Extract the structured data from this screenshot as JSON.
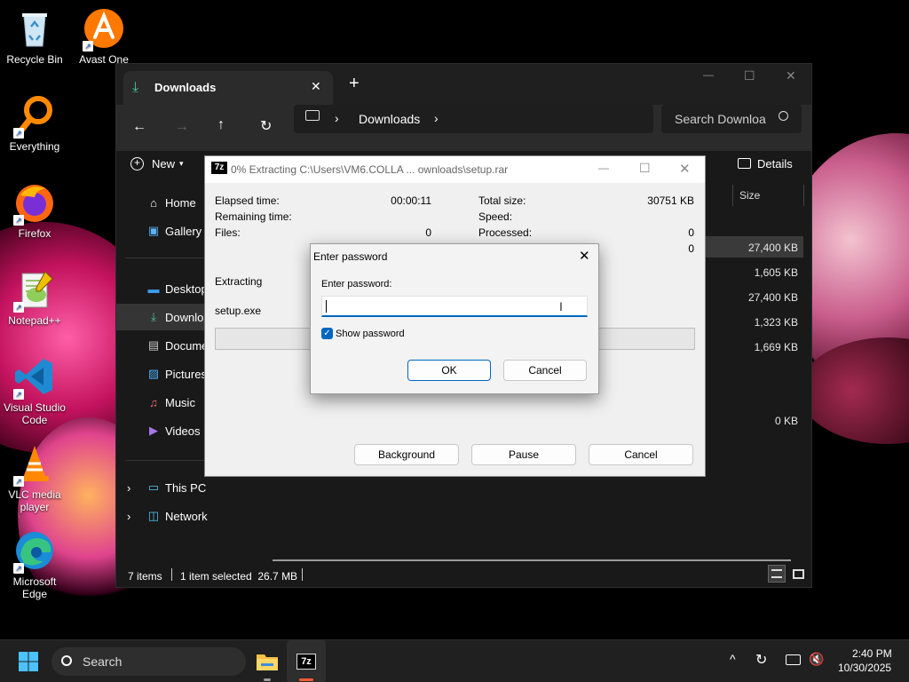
{
  "desktop": {
    "icons": [
      {
        "label": "Recycle Bin",
        "icon": "recycle-bin-icon"
      },
      {
        "label": "Avast One",
        "icon": "avast-icon"
      },
      {
        "label": "Everything",
        "icon": "everything-search-icon"
      },
      {
        "label": "Firefox",
        "icon": "firefox-icon"
      },
      {
        "label": "Notepad++",
        "icon": "notepad-plus-plus-icon"
      },
      {
        "label": "Visual Studio Code",
        "icon": "vscode-icon"
      },
      {
        "label": "VLC media player",
        "icon": "vlc-icon"
      },
      {
        "label": "Microsoft Edge",
        "icon": "edge-icon"
      }
    ]
  },
  "explorer": {
    "tab_title": "Downloads",
    "new_tab_symbol": "+",
    "window_controls": {
      "minimize": "—",
      "maximize": "☐",
      "close": "✕"
    },
    "breadcrumb": [
      "Downloads"
    ],
    "search_placeholder": "Search Downloa",
    "toolbar": {
      "new_label": "New",
      "details_label": "Details"
    },
    "column_header": "Size",
    "nav": [
      {
        "label": "Home",
        "icon": "home-icon"
      },
      {
        "label": "Gallery",
        "icon": "gallery-icon"
      },
      {
        "label": "Desktop",
        "icon": "desktop-folder-icon"
      },
      {
        "label": "Downloads",
        "icon": "download-icon"
      },
      {
        "label": "Documents",
        "icon": "documents-icon"
      },
      {
        "label": "Pictures",
        "icon": "pictures-icon"
      },
      {
        "label": "Music",
        "icon": "music-icon"
      },
      {
        "label": "Videos",
        "icon": "videos-icon"
      },
      {
        "label": "This PC",
        "icon": "this-pc-icon"
      },
      {
        "label": "Network",
        "icon": "network-icon"
      }
    ],
    "file_sizes": [
      "27,400 KB",
      "1,605 KB",
      "27,400 KB",
      "1,323 KB",
      "1,669 KB",
      "0 KB"
    ],
    "status": {
      "items": "7 items",
      "selected": "1 item selected  26.7 MB"
    }
  },
  "progress_window": {
    "title": "0% Extracting C:\\Users\\VM6.COLLA ... ownloads\\setup.rar",
    "app_badge": "7z",
    "elapsed_label": "Elapsed time:",
    "elapsed_value": "00:00:11",
    "remaining_label": "Remaining time:",
    "files_label": "Files:",
    "files_value": "0",
    "total_size_label": "Total size:",
    "total_size_value": "30751 KB",
    "speed_label": "Speed:",
    "processed_label": "Processed:",
    "processed_value": "0",
    "extra_value": "0",
    "extracting_label": "Extracting",
    "current_file": "setup.exe",
    "progress_percent": 0,
    "buttons": {
      "background": "Background",
      "pause": "Pause",
      "cancel": "Cancel"
    }
  },
  "password_dialog": {
    "title": "Enter password",
    "field_label": "Enter password:",
    "field_value": "",
    "show_password_label": "Show password",
    "show_password_checked": true,
    "ok_label": "OK",
    "cancel_label": "Cancel"
  },
  "taskbar": {
    "search_label": "Search",
    "time": "2:40 PM",
    "date": "10/30/2025",
    "app_7z_label": "7z",
    "tray_chevron": "^"
  },
  "colors": {
    "accent": "#0067c0",
    "explorer_bg": "#191919",
    "dialog_bg": "#f3f3f3",
    "taskbar_bg": "#202020"
  }
}
